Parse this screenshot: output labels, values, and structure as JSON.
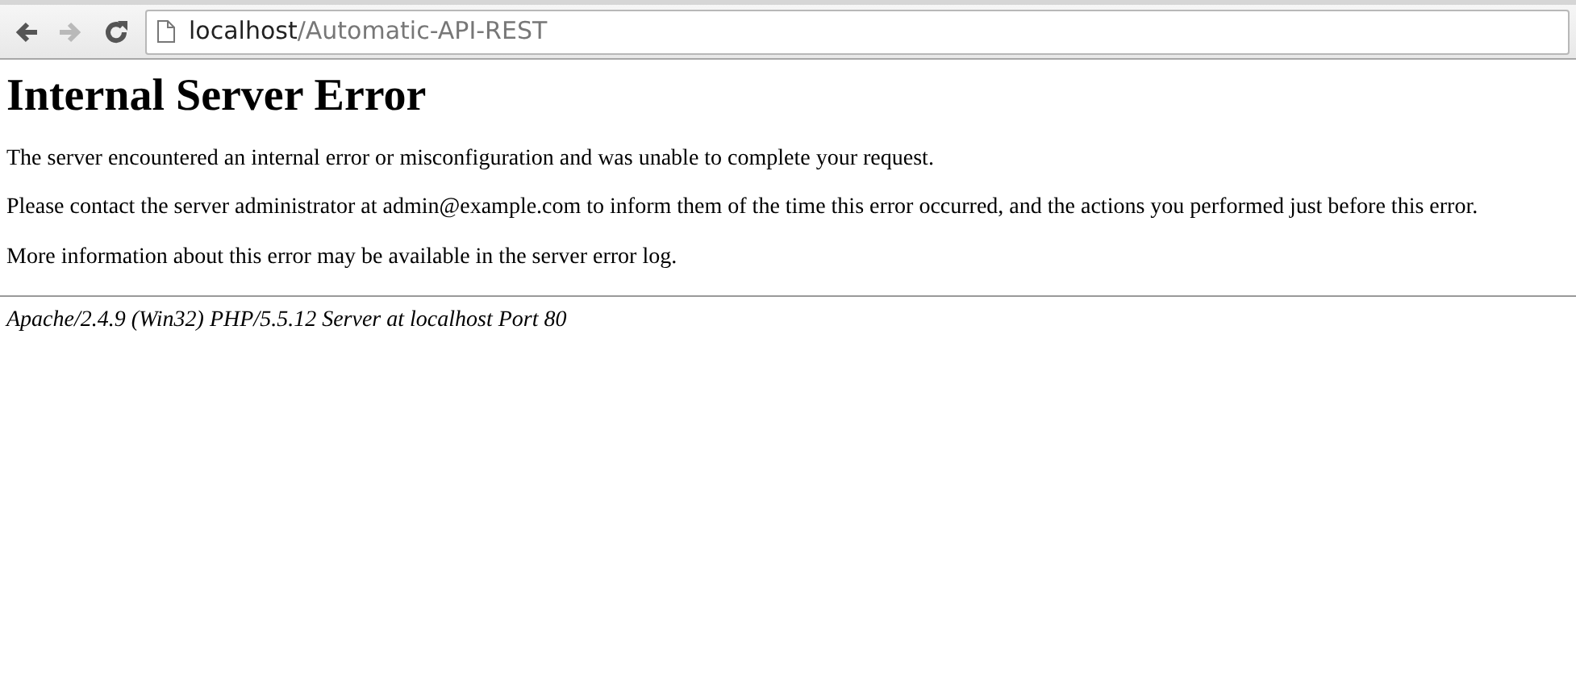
{
  "toolbar": {
    "back": {
      "disabled": false
    },
    "forward": {
      "disabled": true
    },
    "address": {
      "host": "localhost",
      "path": "/Automatic-API-REST"
    }
  },
  "page": {
    "heading": "Internal Server Error",
    "paragraphs": [
      "The server encountered an internal error or misconfiguration and was unable to complete your request.",
      "Please contact the server administrator at admin@example.com to inform them of the time this error occurred, and the actions you performed just before this error.",
      "More information about this error may be available in the server error log."
    ],
    "signature": "Apache/2.4.9 (Win32) PHP/5.5.12 Server at localhost Port 80"
  }
}
